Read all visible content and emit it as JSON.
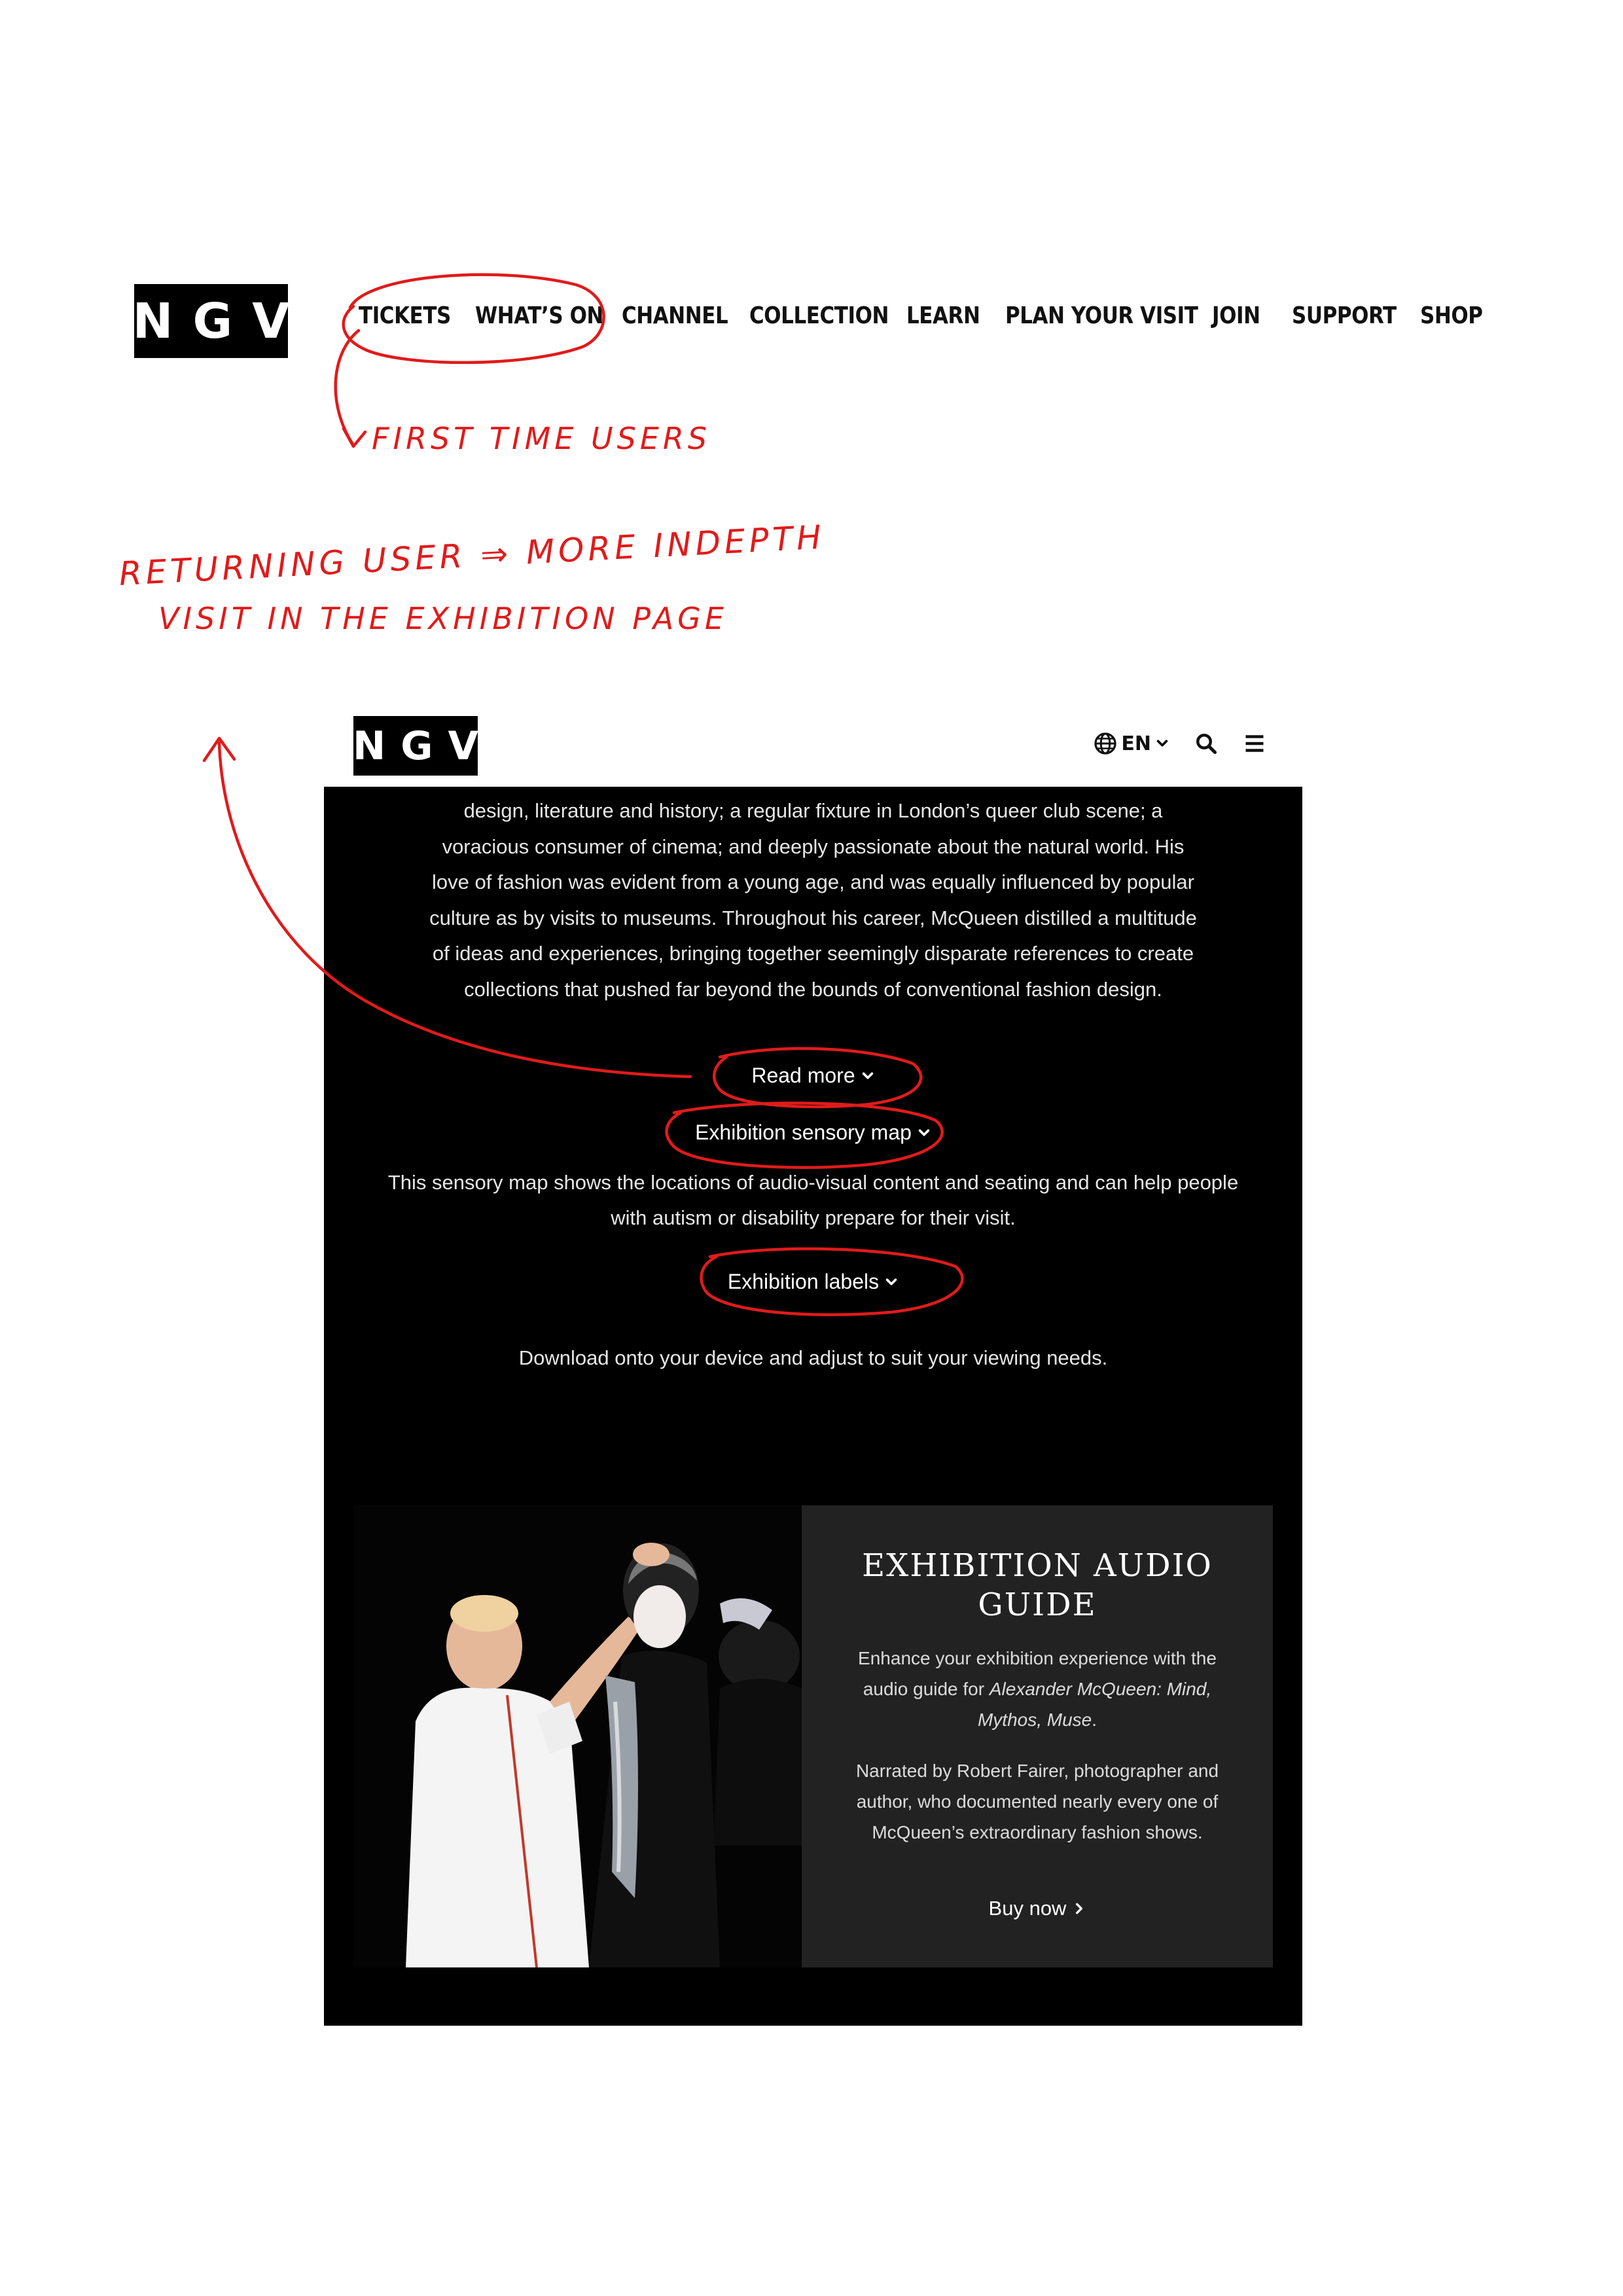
{
  "top_header": {
    "logo": "NGV",
    "nav": [
      {
        "label": "TICKETS"
      },
      {
        "label": "WHAT’S ON"
      },
      {
        "label": "CHANNEL"
      },
      {
        "label": "COLLECTION"
      },
      {
        "label": "LEARN"
      },
      {
        "label": "PLAN YOUR VISIT"
      },
      {
        "label": "JOIN"
      },
      {
        "label": "SUPPORT"
      },
      {
        "label": "SHOP"
      }
    ]
  },
  "annotations": {
    "first_time": "FIRST TIME USERS",
    "returning_line1": "RETURNING USER",
    "returning_arrow": "⇒",
    "returning_line1b": "MORE INDEPTH",
    "returning_line2": "VISIT IN THE EXHIBITION PAGE",
    "color": "#e01b1b"
  },
  "mobile": {
    "logo": "NGV",
    "lang": "EN",
    "icons": {
      "globe": "globe-icon",
      "chevron": "chevron-down-icon",
      "search": "search-icon",
      "menu": "hamburger-menu-icon"
    },
    "intro_lines": [
      "design, literature and history; a regular fixture in London’s queer club scene; a",
      "voracious consumer of cinema; and deeply passionate about the natural world. His",
      "love of fashion was evident from a young age, and was equally influenced by popular",
      "culture as by visits to museums. Throughout his career, McQueen distilled a multitude",
      "of ideas and experiences, bringing together seemingly disparate references to create",
      "collections that pushed far beyond the bounds of conventional fashion design."
    ],
    "read_more": "Read more",
    "sensory_map": {
      "label": "Exhibition sensory map",
      "line1": "This sensory map shows the locations of audio-visual content and seating and can help people",
      "line2": "with autism or disability prepare for their visit."
    },
    "labels": {
      "label": "Exhibition labels",
      "desc": "Download onto your device and adjust to suit your viewing needs."
    },
    "audio_guide": {
      "title_line1": "EXHIBITION AUDIO",
      "title_line2": "GUIDE",
      "p1_a": "Enhance your exhibition experience with the audio guide for ",
      "p1_em": "Alexander McQueen: Mind, Mythos, Muse",
      "p1_b": ".",
      "p2": "Narrated by Robert Fairer, photographer and author, who documented nearly every one of McQueen’s extraordinary fashion shows.",
      "buy": "Buy now"
    }
  }
}
